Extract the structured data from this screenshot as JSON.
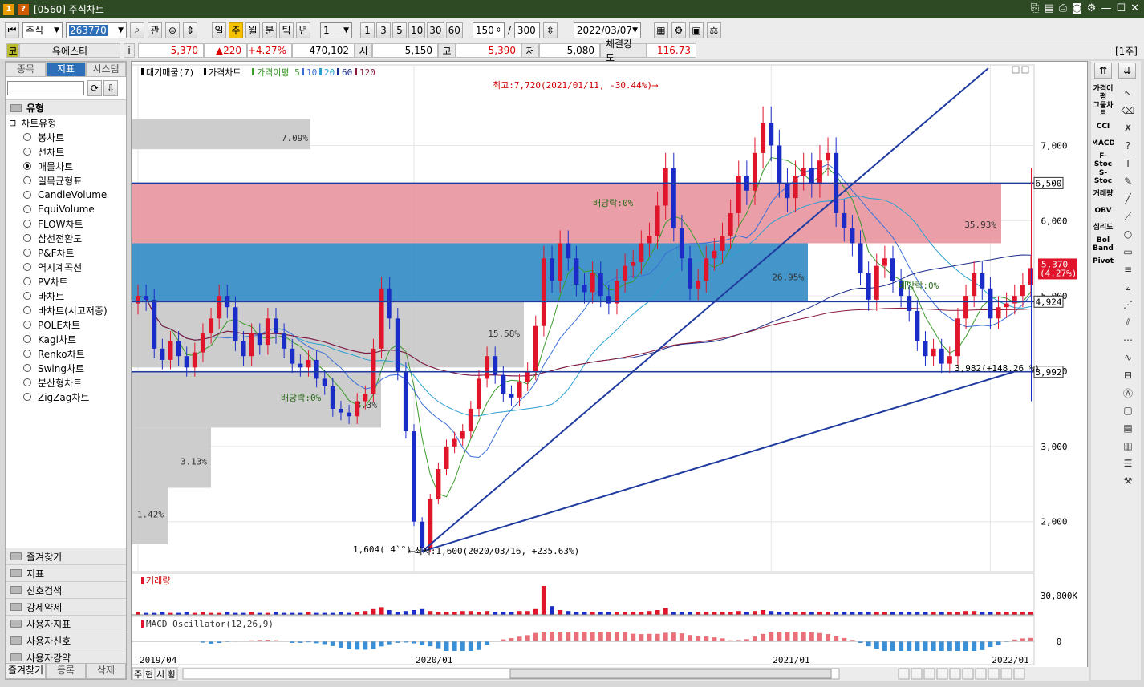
{
  "window": {
    "title": "[0560] 주식차트",
    "icon1": "1",
    "icon2": "?"
  },
  "toolbar": {
    "market": "주식",
    "code": "263770",
    "btn_kwan": "관",
    "periods": [
      "일",
      "주",
      "월",
      "분",
      "틱",
      "년"
    ],
    "active_period": "주",
    "combo_value": "1",
    "quick_counts": [
      "1",
      "3",
      "5",
      "10",
      "30",
      "60"
    ],
    "count": "150",
    "slash": "/",
    "total": "300",
    "date": "2022/03/07"
  },
  "quote": {
    "stock_tag": "코",
    "stock_name": "유에스티",
    "info_icon": "i",
    "price": "5,370",
    "change": "▲220",
    "change_pct": "+4.27%",
    "volume": "470,102",
    "open_label": "시",
    "open": "5,150",
    "high_label": "고",
    "high": "5,390",
    "low_label": "저",
    "low": "5,080",
    "strength_label": "체결강도",
    "strength": "116.73",
    "unit": "[1주]"
  },
  "sidebar": {
    "tabs": [
      "종목",
      "지표",
      "시스템"
    ],
    "active_tab": "지표",
    "section_type": "유형",
    "tree_root": "차트유형",
    "chart_types": [
      "봉차트",
      "선차트",
      "매물차트",
      "일목균형표",
      "CandleVolume",
      "EquiVolume",
      "FLOW차트",
      "삼선전환도",
      "P&F차트",
      "역시계곡선",
      "PV차트",
      "바차트",
      "바차트(시고저종)",
      "POLE차트",
      "Kagi차트",
      "Renko차트",
      "Swing차트",
      "분산형차트",
      "ZigZag차트"
    ],
    "selected_type": "매물차트",
    "bottom_sections": [
      "즐겨찾기",
      "지표",
      "신호검색",
      "강세약세",
      "사용자지표",
      "사용자신호",
      "사용자강약"
    ],
    "bottom_tabs": [
      "즐겨찾기",
      "등록",
      "삭제"
    ]
  },
  "main_chart": {
    "legend": [
      "대기매물(7)",
      "가격차트",
      "가격이평 5",
      "10",
      "20",
      "60",
      "120"
    ],
    "price_labels": [
      "7,000",
      "6,000",
      "5,000",
      "4,000",
      "3,000",
      "2,000"
    ],
    "volume_profile": [
      {
        "pct": "7.09%"
      },
      {
        "pct": "35.93%"
      },
      {
        "pct": "26.95%"
      },
      {
        "pct": "15.58%"
      },
      {
        "pct": "8.3%"
      },
      {
        "pct": "3.13%"
      },
      {
        "pct": "1.42%"
      }
    ],
    "annotations": {
      "high": "최고:7,720(2021/01/11, -30.44%)⟶",
      "low": "⟵최저:1,600(2020/03/16, +235.63%)",
      "low_left": "1,604( 4̀ °)",
      "dividend": "배당락:0%",
      "trendpoint": "3,982(+148.26 %)"
    },
    "hlines": [
      "6,500",
      "4,924",
      "3,992"
    ],
    "current_price": "5,370",
    "current_pct": "(4.27%)",
    "series": [
      {
        "name": "price",
        "values": [
          5000,
          4950,
          4300,
          4150,
          4400,
          4200,
          4050,
          4250,
          4500,
          4700,
          5000,
          4850,
          4400,
          4200,
          4500,
          4350,
          4700,
          4500,
          4300,
          4100,
          4050,
          4150,
          3900,
          3800,
          3500,
          3450,
          3400,
          3600,
          3700,
          4300,
          5100,
          4700,
          4000,
          3200,
          2000,
          1650,
          2300,
          2700,
          3000,
          3100,
          3200,
          3500,
          3900,
          4200,
          3950,
          3700,
          3650,
          3850,
          4000,
          4600,
          5500,
          5200,
          5700,
          5500,
          5150,
          5050,
          5300,
          5000,
          4900,
          5200,
          5400,
          5450,
          5700,
          5800,
          6200,
          6700,
          5900,
          5500,
          5100,
          5200,
          5500,
          5600,
          5800,
          6100,
          6600,
          6400,
          6900,
          7300,
          7000,
          6500,
          6300,
          6600,
          6700,
          6500,
          6800,
          6900,
          6100,
          5900,
          5700,
          5300,
          4950,
          5400,
          5500,
          5200,
          5000,
          4800,
          4400,
          4200,
          4300,
          4100,
          4200,
          4700,
          5000,
          5300,
          5100,
          4700,
          4850,
          4900,
          5000,
          5150,
          5370
        ]
      },
      {
        "name": "volume",
        "values": [
          3,
          2,
          2,
          3,
          2,
          2,
          3,
          2,
          3,
          2,
          2,
          3,
          2,
          2,
          3,
          2,
          2,
          3,
          2,
          2,
          2,
          3,
          2,
          2,
          2,
          3,
          2,
          3,
          4,
          6,
          8,
          5,
          3,
          4,
          5,
          6,
          4,
          3,
          3,
          3,
          4,
          4,
          3,
          4,
          3,
          3,
          3,
          4,
          4,
          6,
          30,
          9,
          5,
          4,
          3,
          3,
          3,
          3,
          3,
          3,
          3,
          3,
          3,
          4,
          5,
          7,
          3,
          3,
          3,
          3,
          3,
          3,
          3,
          3,
          4,
          3,
          4,
          5,
          4,
          3,
          3,
          3,
          3,
          3,
          3,
          3,
          3,
          3,
          3,
          3,
          3,
          3,
          3,
          3,
          3,
          3,
          3,
          3,
          3,
          3,
          3,
          3,
          4,
          4,
          3,
          3,
          3,
          3,
          3,
          3,
          3
        ]
      }
    ]
  },
  "volume_chart": {
    "title": "거래량",
    "axis": "30,000K"
  },
  "macd_chart": {
    "title": "MACD Oscillator(12,26,9)",
    "axis": "0"
  },
  "date_axis": [
    "2019/04",
    "2020/01",
    "2021/01",
    "2022/01"
  ],
  "bottom_bar": {
    "buttons": [
      "주",
      "현",
      "시",
      "황"
    ]
  },
  "right_tools": [
    "가격이평",
    "그물차트",
    "CCI",
    "MACD",
    "F-Stoc",
    "S-Stoc",
    "거래량",
    "OBV",
    "심리도",
    "Bol Band",
    "Pivot"
  ],
  "colors": {
    "up": "#e0142a",
    "down": "#1a2bc8",
    "hline": "#1f3b9f",
    "zone_red": "#e8959f",
    "zone_blue": "#3a8fc6",
    "zone_gray": "#c8c8c8"
  }
}
